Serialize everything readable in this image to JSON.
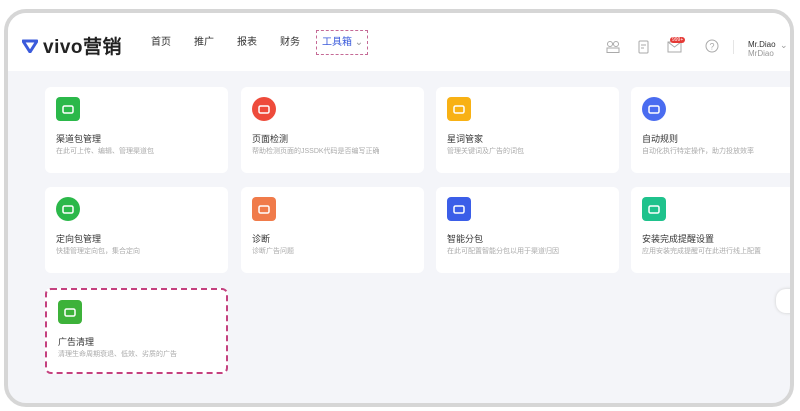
{
  "header": {
    "logo": "vivo营销",
    "nav": [
      "首页",
      "推广",
      "报表",
      "财务"
    ],
    "toolbox": "工具箱",
    "mail_badge": "999+",
    "user_name": "Mr.Diao",
    "user_sub": "MrDiao"
  },
  "tools": [
    {
      "title": "渠道包管理",
      "desc": "在此可上传、编辑、管理渠道包",
      "icon": "android-icon",
      "color": "#2bb84a"
    },
    {
      "title": "页面检测",
      "desc": "帮助检测页面的JSSDK代码是否编写正确",
      "icon": "page-search-icon",
      "color": "#ee4b3b"
    },
    {
      "title": "星词管家",
      "desc": "管理关键词及广告的词包",
      "icon": "search-icon",
      "color": "#f8b114"
    },
    {
      "title": "自动规则",
      "desc": "自动化执行特定操作，助力投放效率",
      "icon": "auto-play-icon",
      "color": "#4a6cf0"
    },
    {
      "title": "定向包管理",
      "desc": "快捷管理定向包，集合定向",
      "icon": "archive-icon",
      "color": "#2bb84a"
    },
    {
      "title": "诊断",
      "desc": "诊断广告问题",
      "icon": "diagnose-icon",
      "color": "#f07b4a"
    },
    {
      "title": "智能分包",
      "desc": "在此可配置智能分包以用于渠道归因",
      "icon": "android-icon",
      "color": "#3b5ee8"
    },
    {
      "title": "安装完成提醒设置",
      "desc": "应用安装完成提醒可在此进行线上配置",
      "icon": "install-reminder-icon",
      "color": "#1fc28c"
    },
    {
      "title": "广告清理",
      "desc": "清理生命周期衰退、低效、劣质的广告",
      "icon": "basket-icon",
      "color": "#3db23a"
    }
  ]
}
